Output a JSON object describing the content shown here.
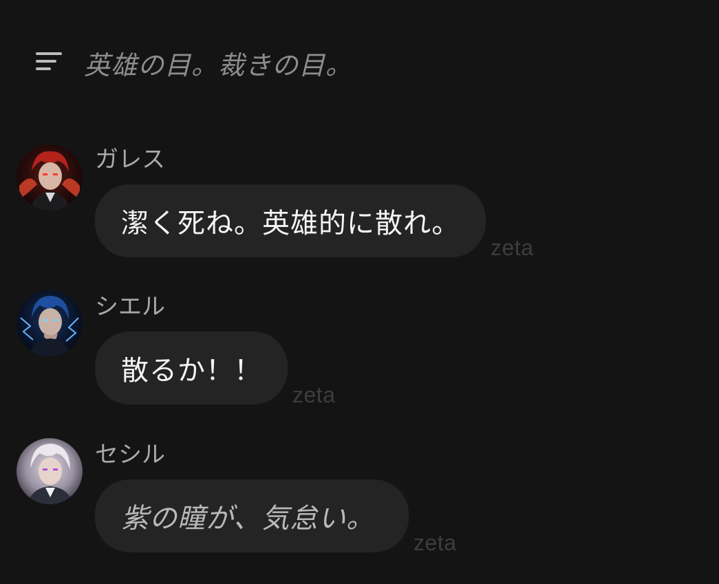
{
  "header": {
    "menu_icon": "hamburger-menu-icon",
    "title": "英雄の目。裁きの目。"
  },
  "messages": [
    {
      "sender": "ガレス",
      "text": "潔く死ね。英雄的に散れ。",
      "italic": false,
      "watermark": "zeta",
      "avatar_accent": "#d9332b"
    },
    {
      "sender": "シエル",
      "text": "散るか！！",
      "italic": false,
      "watermark": "zeta",
      "avatar_accent": "#3b7dd8"
    },
    {
      "sender": "セシル",
      "text": "紫の瞳が、気怠い。",
      "italic": true,
      "watermark": "zeta",
      "avatar_accent": "#c98fd6"
    }
  ],
  "colors": {
    "background": "#141414",
    "bubble": "#242424",
    "text": "#f4f4f4",
    "muted": "#8d8d8d"
  }
}
